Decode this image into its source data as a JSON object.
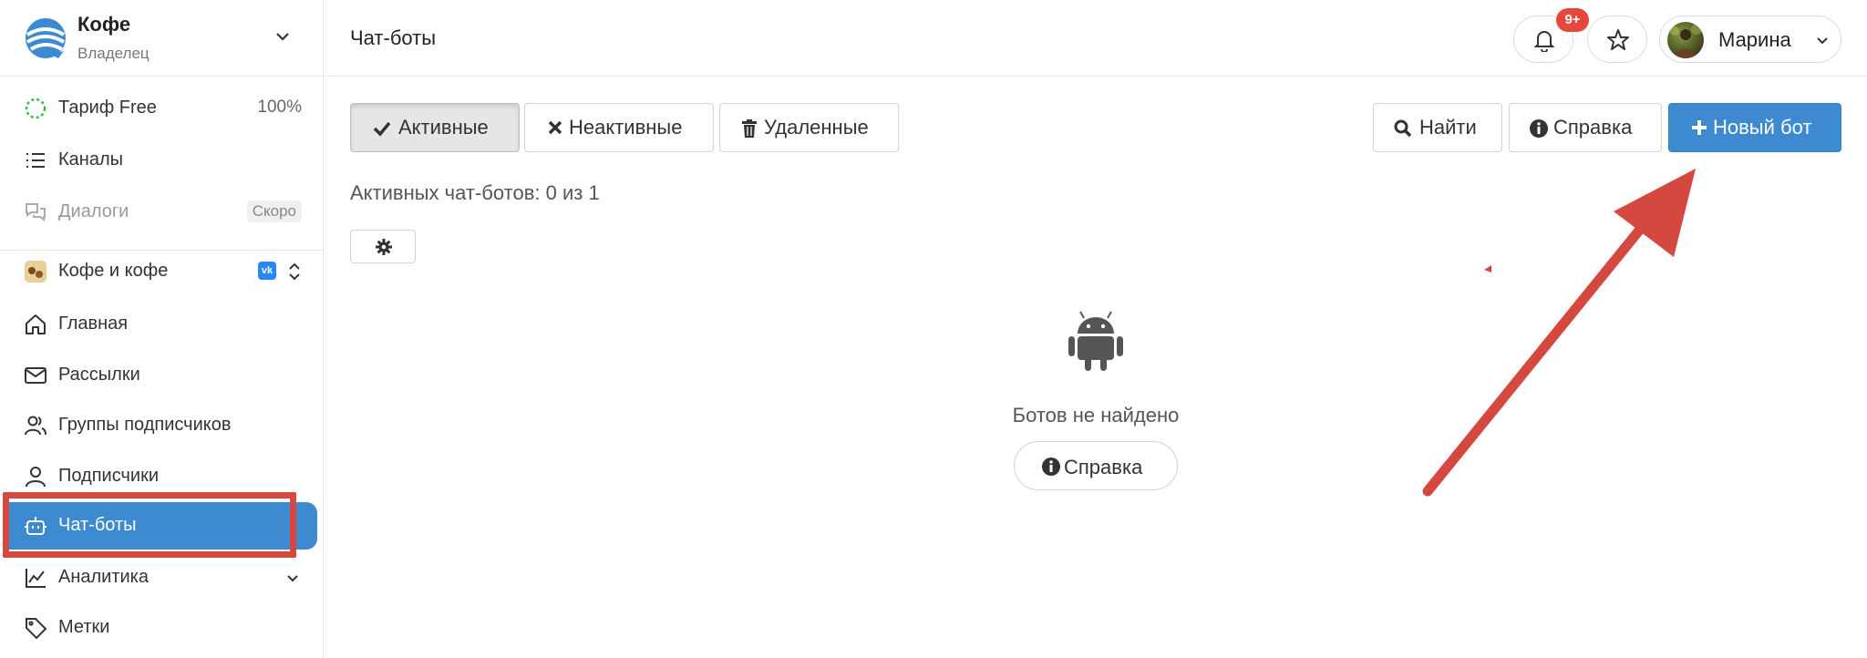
{
  "org": {
    "name": "Кофе",
    "role": "Владелец"
  },
  "sidebar": {
    "tariff": {
      "label": "Тариф Free",
      "value": "100%"
    },
    "channels": {
      "label": "Каналы"
    },
    "dialogs": {
      "label": "Диалоги",
      "badge": "Скоро"
    },
    "project": {
      "label": "Кофе и кофе",
      "network": "VK"
    },
    "items": [
      {
        "label": "Главная",
        "icon": "home-icon"
      },
      {
        "label": "Рассылки",
        "icon": "mail-icon"
      },
      {
        "label": "Группы подписчиков",
        "icon": "users-icon"
      },
      {
        "label": "Подписчики",
        "icon": "user-icon"
      },
      {
        "label": "Чат-боты",
        "icon": "bot-icon",
        "active": true
      },
      {
        "label": "Аналитика",
        "icon": "chart-icon"
      },
      {
        "label": "Метки",
        "icon": "tag-icon"
      }
    ]
  },
  "header": {
    "title": "Чат-боты",
    "notif_count": "9+",
    "user_name": "Марина"
  },
  "filters": {
    "active": "Активные",
    "inactive": "Неактивные",
    "deleted": "Удаленные"
  },
  "actions": {
    "find": "Найти",
    "help": "Справка",
    "new_bot": "Новый бот"
  },
  "main": {
    "count_text": "Активных чат-ботов: 0 из 1",
    "empty_text": "Ботов не найдено",
    "help_label": "Справка"
  },
  "colors": {
    "accent": "#3d8ad1",
    "highlight": "#d5483f",
    "badge": "#e5473c"
  }
}
